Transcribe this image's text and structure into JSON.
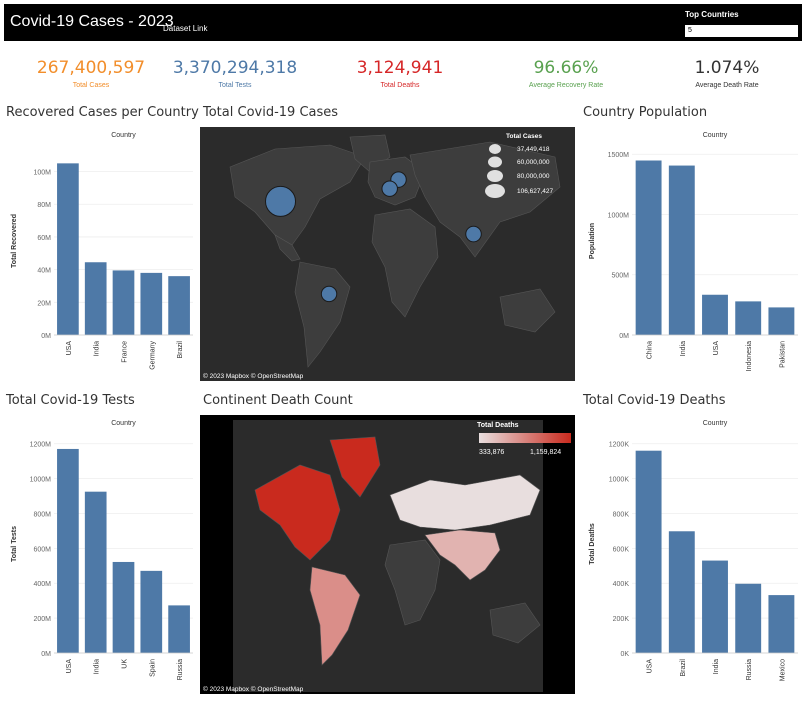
{
  "header": {
    "title": "Covid-19 Cases - 2023",
    "dataset_link": "Dataset Link",
    "top_countries_label": "Top Countries",
    "top_countries_value": "5"
  },
  "kpis": [
    {
      "value": "267,400,597",
      "label": "Total Cases",
      "color": "#f28e2b"
    },
    {
      "value": "3,370,294,318",
      "label": "Total Tests",
      "color": "#4e79a7"
    },
    {
      "value": "3,124,941",
      "label": "Total Deaths",
      "color": "#d62728"
    },
    {
      "value": "96.66%",
      "label": "Average Recovery Rate",
      "color": "#59a14f"
    },
    {
      "value": "1.074%",
      "label": "Average Death Rate",
      "color": "#333333"
    }
  ],
  "sections": {
    "recovered": "Recovered Cases per Country",
    "total_cases": "Total Covid-19 Cases",
    "population": "Country Population",
    "tests": "Total Covid-19 Tests",
    "continent_deaths": "Continent Death Count",
    "deaths": "Total Covid-19 Deaths"
  },
  "map_attribution": "© 2023 Mapbox © OpenStreetMap",
  "colors": {
    "bar": "#4e79a7",
    "map_bg": "#2b2b2b",
    "land": "#3d3d3d",
    "bubble": "#4e79a7"
  },
  "chart_data": [
    {
      "id": "recovered",
      "type": "bar",
      "title": "Country",
      "ylabel": "Total Recovered",
      "categories": [
        "USA",
        "India",
        "France",
        "Germany",
        "Brazil"
      ],
      "values": [
        105000000,
        44500000,
        39500000,
        38000000,
        36000000
      ],
      "ylim": [
        0,
        115000000
      ],
      "ticks": [
        0,
        20000000,
        40000000,
        60000000,
        80000000,
        100000000
      ],
      "tick_labels": [
        "0M",
        "20M",
        "40M",
        "60M",
        "80M",
        "100M"
      ]
    },
    {
      "id": "population",
      "type": "bar",
      "title": "Country",
      "ylabel": "Population",
      "categories": [
        "China",
        "India",
        "USA",
        "Indonesia",
        "Pakistan"
      ],
      "values": [
        1448000000,
        1406000000,
        334000000,
        279000000,
        229000000
      ],
      "ylim": [
        0,
        1560000000
      ],
      "ticks": [
        0,
        500000000,
        1000000000,
        1500000000
      ],
      "tick_labels": [
        "0M",
        "500M",
        "1000M",
        "1500M"
      ]
    },
    {
      "id": "tests",
      "type": "bar",
      "title": "Country",
      "ylabel": "Total Tests",
      "categories": [
        "USA",
        "India",
        "UK",
        "Spain",
        "Russia"
      ],
      "values": [
        1170000000,
        925000000,
        522000000,
        471000000,
        273000000
      ],
      "ylim": [
        0,
        1250000000
      ],
      "ticks": [
        0,
        200000000,
        400000000,
        600000000,
        800000000,
        1000000000,
        1200000000
      ],
      "tick_labels": [
        "0M",
        "200M",
        "400M",
        "600M",
        "800M",
        "1000M",
        "1200M"
      ]
    },
    {
      "id": "deaths",
      "type": "bar",
      "title": "Country",
      "ylabel": "Total Deaths",
      "categories": [
        "USA",
        "Brazil",
        "India",
        "Russia",
        "Mexico"
      ],
      "values": [
        1160000,
        698000,
        530000,
        397000,
        332000
      ],
      "ylim": [
        0,
        1250000
      ],
      "ticks": [
        0,
        200000,
        400000,
        600000,
        800000,
        1000000,
        1200000
      ],
      "tick_labels": [
        "0K",
        "200K",
        "400K",
        "600K",
        "800K",
        "1000K",
        "1200K"
      ]
    },
    {
      "id": "total_cases_map",
      "type": "scatter",
      "title": "Total Cases",
      "legend_values": [
        "37,449,418",
        "60,000,000",
        "80,000,000",
        "106,627,427"
      ],
      "points": [
        {
          "lon": -97,
          "lat": 39,
          "value": 106627427
        },
        {
          "lon": 10,
          "lat": 51,
          "value": 38400000
        },
        {
          "lon": 2,
          "lat": 46,
          "value": 39900000
        },
        {
          "lon": 78,
          "lat": 21,
          "value": 44700000
        },
        {
          "lon": -53,
          "lat": -12,
          "value": 37449418
        }
      ]
    },
    {
      "id": "continent_deaths_map",
      "type": "heatmap",
      "title": "Total Deaths",
      "legend_min": "333,876",
      "legend_max": "1,159,824",
      "continents": [
        {
          "name": "North America",
          "value": 1159824
        },
        {
          "name": "South America",
          "value": 700000
        },
        {
          "name": "Europe",
          "value": 333876
        },
        {
          "name": "Asia",
          "value": 530000
        }
      ]
    }
  ]
}
